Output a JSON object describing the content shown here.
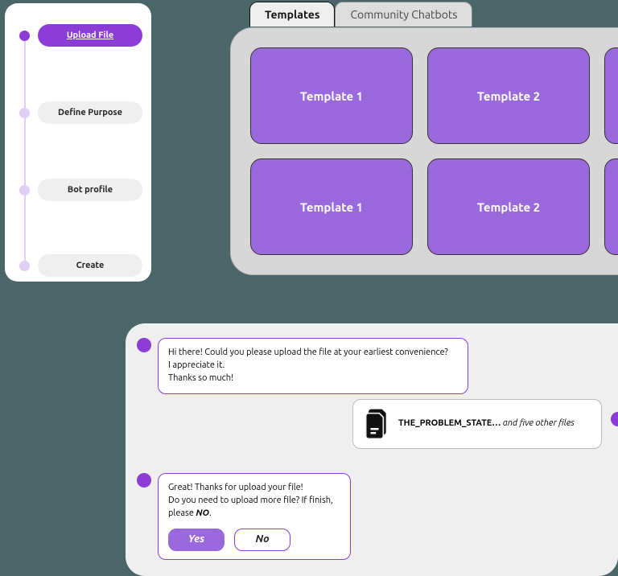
{
  "stepper": {
    "steps": [
      {
        "label": "Upload File",
        "active": true
      },
      {
        "label": "Define Purpose",
        "active": false
      },
      {
        "label": "Bot profile",
        "active": false
      },
      {
        "label": "Create",
        "active": false
      }
    ]
  },
  "tabs": {
    "active": "Templates",
    "inactive": "Community Chatbots"
  },
  "templates": {
    "row1": [
      "Template 1",
      "Template 2"
    ],
    "row2": [
      "Template 1",
      "Template 2"
    ]
  },
  "chat": {
    "bot_msg1_line1": "Hi there! Could you please upload the file at your earliest convenience?",
    "bot_msg1_line2": "I appreciate it.",
    "bot_msg1_line3": "Thanks so much!",
    "upload_name": "THE_PROBLEM_STATE…",
    "upload_suffix": " and five other files",
    "bot_msg2_line1": "Great! Thanks for upload your file!",
    "bot_msg2_line2_a": "Do you need to upload more file? If finish, please ",
    "bot_msg2_line2_b": "NO",
    "bot_msg2_line2_c": ".",
    "yes": "Yes",
    "no": "No"
  }
}
